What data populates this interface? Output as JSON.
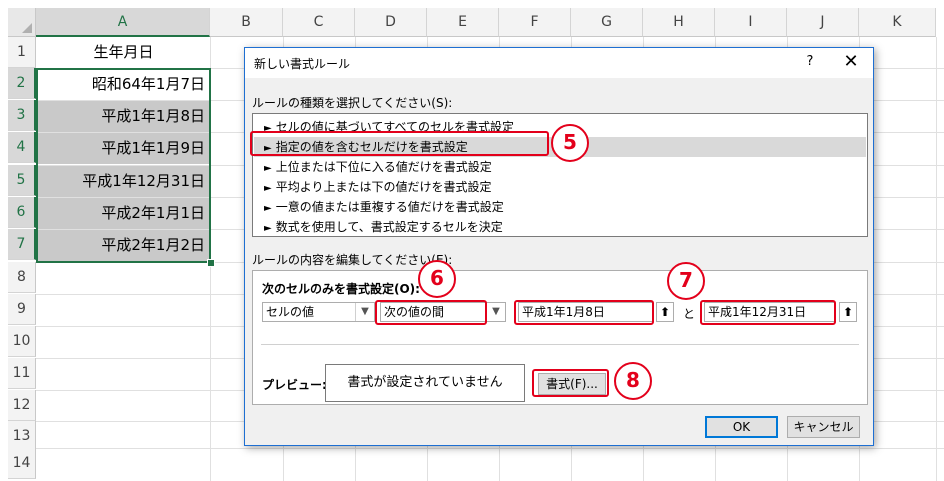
{
  "spreadsheet": {
    "columns": [
      "A",
      "B",
      "C",
      "D",
      "E",
      "F",
      "G",
      "H",
      "I",
      "J",
      "K"
    ],
    "rows": [
      "1",
      "2",
      "3",
      "4",
      "5",
      "6",
      "7",
      "8",
      "9",
      "10",
      "11",
      "12",
      "13",
      "14"
    ],
    "cells": {
      "a1": "生年月日",
      "a2": "昭和64年1月7日",
      "a3": "平成1年1月8日",
      "a4": "平成1年1月9日",
      "a5": "平成1年12月31日",
      "a6": "平成2年1月1日",
      "a7": "平成2年1月2日"
    }
  },
  "dialog": {
    "title": "新しい書式ルール",
    "help": "?",
    "close": "✕",
    "rule_type_label": "ルールの種類を選択してください(S):",
    "rule_types": [
      "セルの値に基づいてすべてのセルを書式設定",
      "指定の値を含むセルだけを書式設定",
      "上位または下位に入る値だけを書式設定",
      "平均より上または下の値だけを書式設定",
      "一意の値または重複する値だけを書式設定",
      "数式を使用して、書式設定するセルを決定"
    ],
    "edit_label": "ルールの内容を編集してください(E):",
    "format_only_label": "次のセルのみを書式設定(O):",
    "condition_type": "セルの値",
    "operator": "次の値の間",
    "value1": "平成1年1月8日",
    "and_label": "と",
    "value2": "平成1年12月31日",
    "preview_label": "プレビュー:",
    "preview_text": "書式が設定されていません",
    "format_button": "書式(F)...",
    "ok_button": "OK",
    "cancel_button": "キャンセル"
  },
  "annotations": {
    "step5": "5",
    "step6": "6",
    "step7": "7",
    "step8": "8"
  },
  "colors": {
    "accent_red": "#e3001b",
    "excel_green": "#217346",
    "dialog_border": "#1e6fd2"
  }
}
